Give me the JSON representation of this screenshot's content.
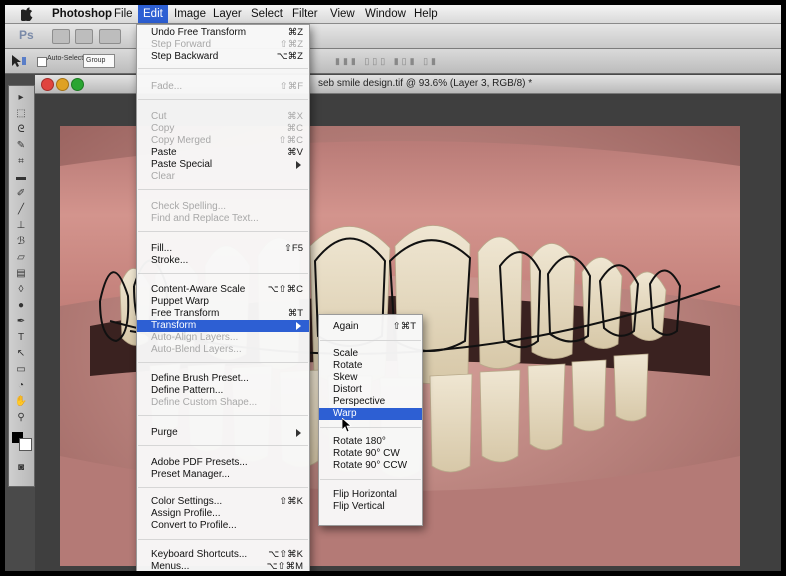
{
  "menubar": {
    "app_name": "Photoshop",
    "items": [
      "File",
      "Edit",
      "Image",
      "Layer",
      "Select",
      "Filter",
      "View",
      "Window",
      "Help"
    ],
    "active": "Edit"
  },
  "appbar": {
    "logo": "Ps"
  },
  "options": {
    "auto_select_label": "Auto-Select:",
    "auto_select_value": "Group"
  },
  "document": {
    "title": "seb smile design.tif @ 93.6% (Layer 3, RGB/8) *"
  },
  "edit_menu": {
    "undo": {
      "label": "Undo Free Transform",
      "shortcut": "⌘Z"
    },
    "step_forward": {
      "label": "Step Forward",
      "shortcut": "⇧⌘Z"
    },
    "step_backward": {
      "label": "Step Backward",
      "shortcut": "⌥⌘Z"
    },
    "fade": {
      "label": "Fade...",
      "shortcut": "⇧⌘F"
    },
    "cut": {
      "label": "Cut",
      "shortcut": "⌘X"
    },
    "copy": {
      "label": "Copy",
      "shortcut": "⌘C"
    },
    "copy_merged": {
      "label": "Copy Merged",
      "shortcut": "⇧⌘C"
    },
    "paste": {
      "label": "Paste",
      "shortcut": "⌘V"
    },
    "paste_special": {
      "label": "Paste Special"
    },
    "clear": {
      "label": "Clear"
    },
    "check_spelling": {
      "label": "Check Spelling..."
    },
    "find_replace": {
      "label": "Find and Replace Text..."
    },
    "fill": {
      "label": "Fill...",
      "shortcut": "⇧F5"
    },
    "stroke": {
      "label": "Stroke..."
    },
    "content_aware": {
      "label": "Content-Aware Scale",
      "shortcut": "⌥⇧⌘C"
    },
    "puppet_warp": {
      "label": "Puppet Warp"
    },
    "free_transform": {
      "label": "Free Transform",
      "shortcut": "⌘T"
    },
    "transform": {
      "label": "Transform"
    },
    "auto_align": {
      "label": "Auto-Align Layers..."
    },
    "auto_blend": {
      "label": "Auto-Blend Layers..."
    },
    "define_brush": {
      "label": "Define Brush Preset..."
    },
    "define_pattern": {
      "label": "Define Pattern..."
    },
    "define_shape": {
      "label": "Define Custom Shape..."
    },
    "purge": {
      "label": "Purge"
    },
    "pdf_presets": {
      "label": "Adobe PDF Presets..."
    },
    "preset_manager": {
      "label": "Preset Manager..."
    },
    "color_settings": {
      "label": "Color Settings...",
      "shortcut": "⇧⌘K"
    },
    "assign_profile": {
      "label": "Assign Profile..."
    },
    "convert_profile": {
      "label": "Convert to Profile..."
    },
    "keyboard_shortcuts": {
      "label": "Keyboard Shortcuts...",
      "shortcut": "⌥⇧⌘K"
    },
    "menus": {
      "label": "Menus...",
      "shortcut": "⌥⇧⌘M"
    }
  },
  "transform_menu": {
    "again": {
      "label": "Again",
      "shortcut": "⇧⌘T"
    },
    "scale": "Scale",
    "rotate": "Rotate",
    "skew": "Skew",
    "distort": "Distort",
    "perspective": "Perspective",
    "warp": "Warp",
    "rotate_180": "Rotate 180°",
    "rotate_90_cw": "Rotate 90° CW",
    "rotate_90_ccw": "Rotate 90° CCW",
    "flip_h": "Flip Horizontal",
    "flip_v": "Flip Vertical"
  },
  "colors": {
    "highlight": "#2d5fd3",
    "gum": "#c98a86",
    "tooth": "#e8dcc4"
  }
}
